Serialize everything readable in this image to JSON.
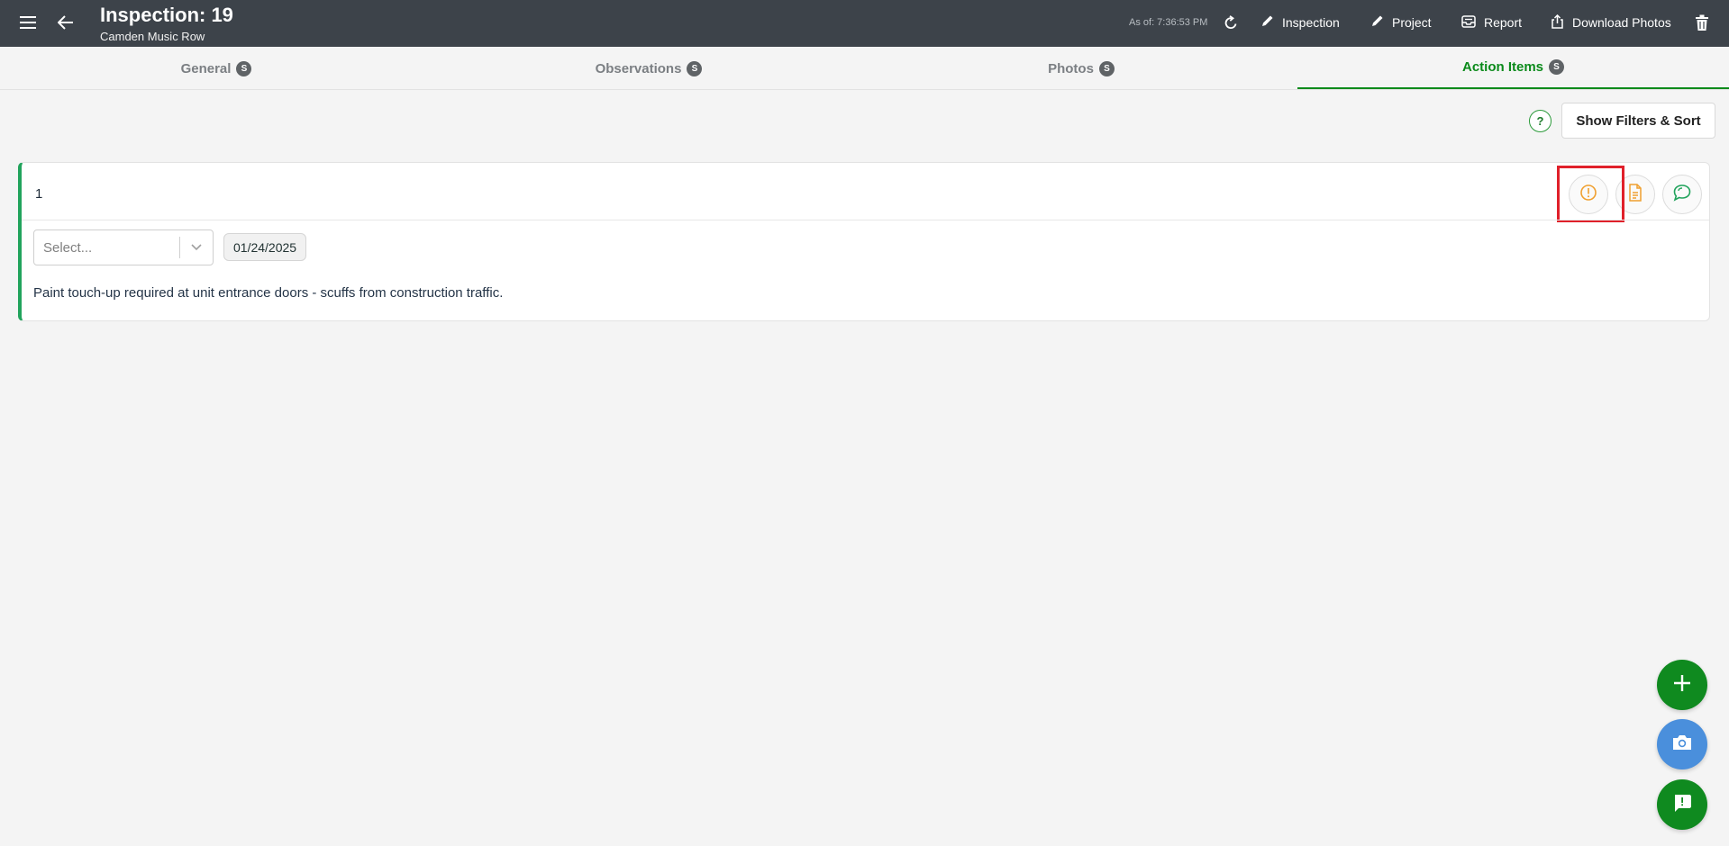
{
  "header": {
    "title": "Inspection: 19",
    "subtitle": "Camden Music Row",
    "as_of": "As of: 7:36:53 PM",
    "actions": [
      {
        "label": "Inspection",
        "icon": "pencil-icon"
      },
      {
        "label": "Project",
        "icon": "pencil-icon"
      },
      {
        "label": "Report",
        "icon": "report-icon"
      },
      {
        "label": "Download Photos",
        "icon": "share-upload-icon"
      }
    ]
  },
  "tabs": [
    {
      "label": "General",
      "badge": "S",
      "active": false
    },
    {
      "label": "Observations",
      "badge": "S",
      "active": false
    },
    {
      "label": "Photos",
      "badge": "S",
      "active": false
    },
    {
      "label": "Action Items",
      "badge": "S",
      "active": true
    }
  ],
  "toolbar": {
    "help_label": "?",
    "filters_label": "Show Filters & Sort"
  },
  "action_item": {
    "number": "1",
    "select_placeholder": "Select...",
    "date": "01/24/2025",
    "description": "Paint touch-up required at unit entrance doors - scuffs from construction traffic.",
    "icons": [
      "exclamation-icon",
      "document-icon",
      "chat-icon"
    ]
  },
  "colors": {
    "header_bg": "#3d434a",
    "accent_green": "#0a8a1a",
    "warning_orange": "#f0a030",
    "camera_blue": "#4a8fdc",
    "highlight_red": "#e0202a"
  }
}
